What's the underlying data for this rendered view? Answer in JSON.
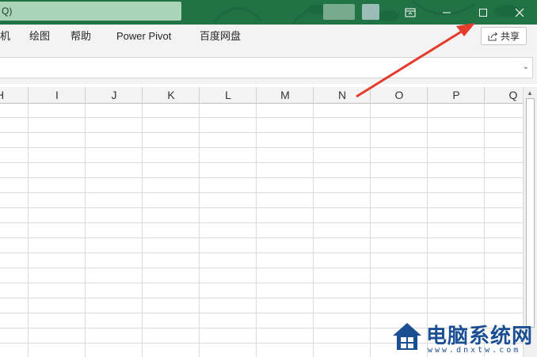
{
  "titlebar": {
    "search_text": "Q)",
    "accent": "#217346"
  },
  "ribbon": {
    "tabs": [
      "机",
      "绘图",
      "帮助",
      "Power Pivot",
      "百度网盘"
    ],
    "share_label": "共享"
  },
  "columns": [
    "H",
    "I",
    "J",
    "K",
    "L",
    "M",
    "N",
    "O",
    "P",
    "Q"
  ],
  "watermark": {
    "title": "电脑系统网",
    "url": "www.dnxtw.com"
  },
  "colors": {
    "annotation_arrow": "#e53b2c",
    "watermark_blue": "#1b4f93"
  }
}
